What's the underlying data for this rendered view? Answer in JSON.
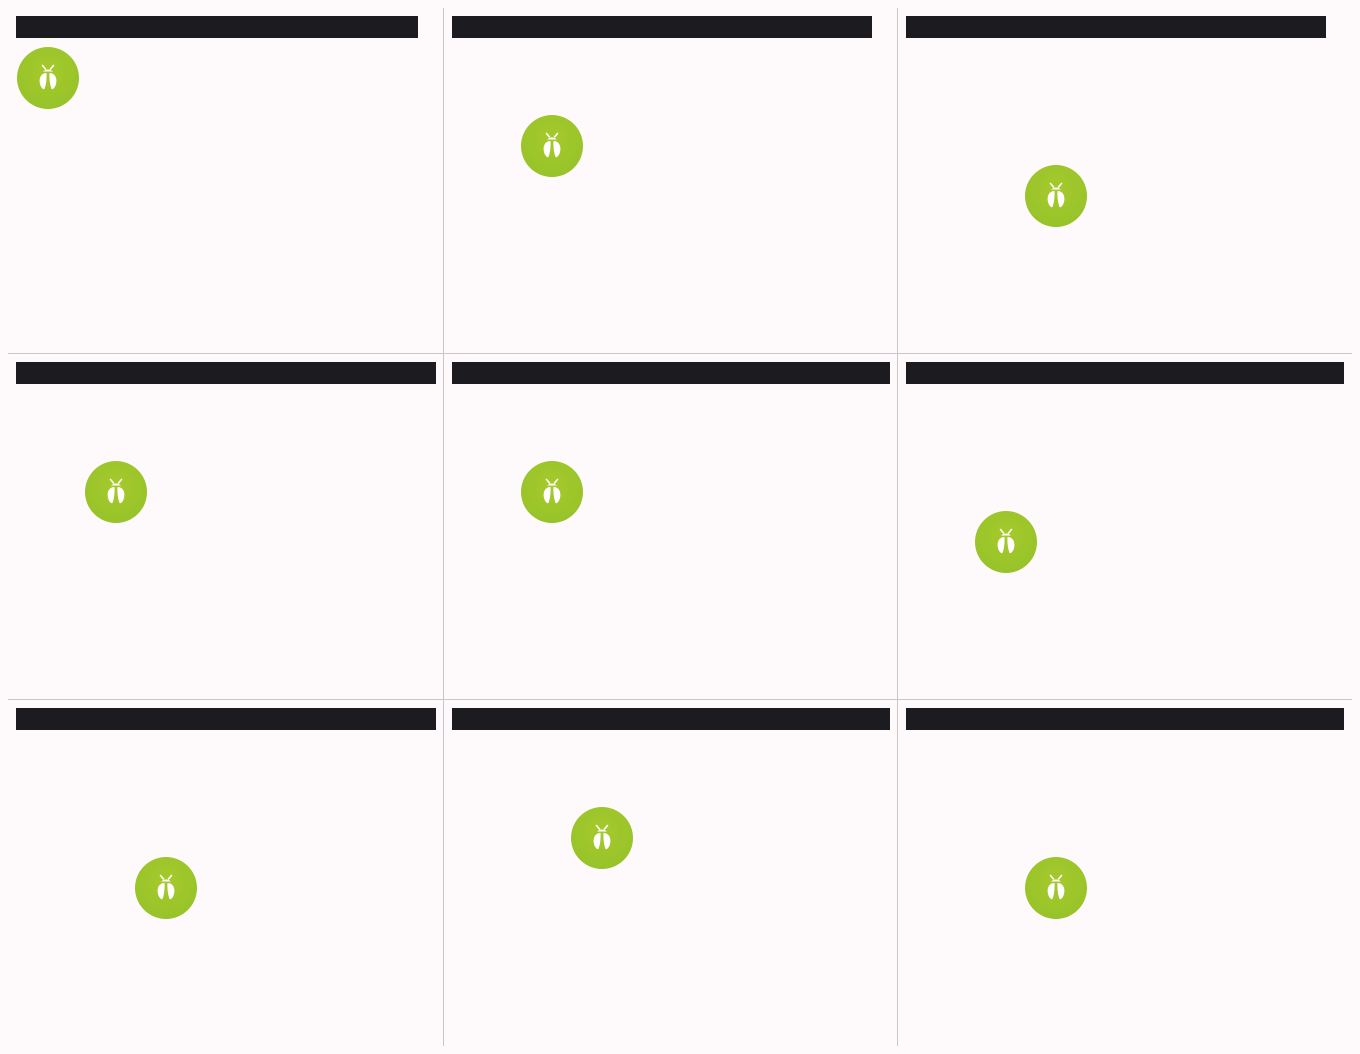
{
  "accent_color": "#9ac52a",
  "bar_color": "#1c1b1f",
  "panels": [
    {
      "icon": "bug-icon"
    },
    {
      "icon": "bug-icon"
    },
    {
      "icon": "bug-icon"
    },
    {
      "icon": "bug-icon"
    },
    {
      "icon": "bug-icon"
    },
    {
      "icon": "bug-icon"
    },
    {
      "icon": "bug-icon"
    },
    {
      "icon": "bug-icon"
    },
    {
      "icon": "bug-icon"
    }
  ]
}
